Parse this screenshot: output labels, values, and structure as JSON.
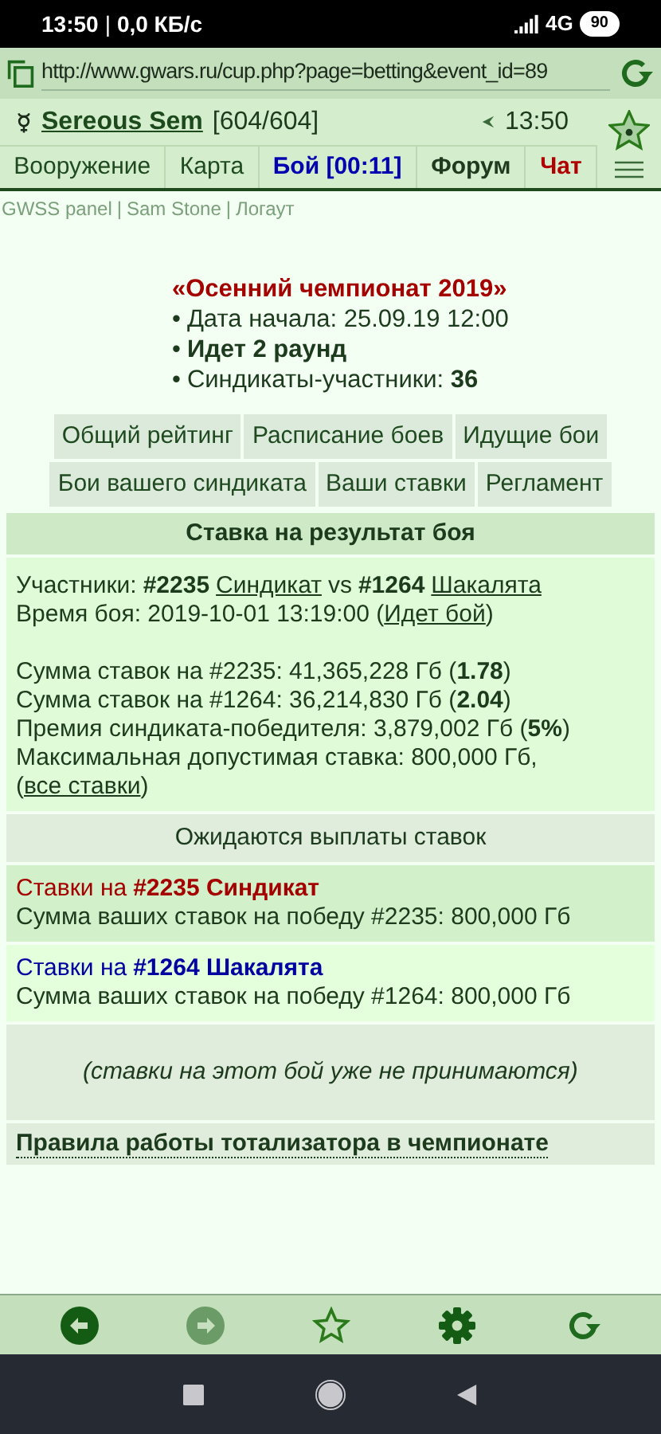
{
  "status_bar": {
    "time": "13:50",
    "separator": "|",
    "speed": "0,0 КБ/с",
    "network": "4G",
    "battery": "90"
  },
  "address_bar": {
    "url": "http://www.gwars.ru/cup.php?page=betting&event_id=89"
  },
  "header": {
    "user_name": "Sereous Sem",
    "hp": "[604/604]",
    "clock": "13:50",
    "nav": [
      {
        "label": "Вооружение",
        "kind": "normal"
      },
      {
        "label": "Карта",
        "kind": "normal"
      },
      {
        "label": "Бой [00:11]",
        "kind": "battle"
      },
      {
        "label": "Форум",
        "kind": "bold"
      },
      {
        "label": "Чат",
        "kind": "chat"
      }
    ]
  },
  "top_links": {
    "separator": "|",
    "items": [
      "GWSS panel",
      "Sam Stone",
      "Логаут"
    ]
  },
  "tournament": {
    "title": "«Осенний чемпионат 2019»",
    "bullet": "•",
    "lines": [
      {
        "text": "Дата начала: 25.09.19 12:00",
        "bold": false
      },
      {
        "text": "Идет 2 раунд",
        "bold": true
      },
      {
        "text": "Синдикаты-участники: **36**",
        "bold": false
      }
    ]
  },
  "menu_rows": [
    [
      "Общий рейтинг",
      "Расписание боев",
      "Идущие бои"
    ],
    [
      "Бои вашего синдиката",
      "Ваши ставки",
      "Регламент"
    ]
  ],
  "bet_panel": {
    "heading": "Ставка на результат боя",
    "participants": {
      "label": "Участники:",
      "team1_id": "#2235",
      "team1_name": "Синдикат",
      "vs": "vs",
      "team2_id": "#1264",
      "team2_name": "Шакалята"
    },
    "time": {
      "text": "Время боя: 2019-10-01 13:19:00 (",
      "link": "Идет бой",
      "suffix": ")"
    },
    "sums": [
      "Сумма ставок на #2235: 41,365,228 Гб (**1.78**)",
      "Сумма ставок на #1264: 36,214,830 Гб (**2.04**)",
      "Премия синдиката-победителя: 3,879,002 Гб (**5%**)"
    ],
    "max_bet": {
      "text": "Максимальная допустимая ставка: 800,000 Гб, (",
      "link": "все ставки",
      "suffix": ")"
    }
  },
  "pending_heading": "Ожидаются выплаты ставок",
  "bets": [
    {
      "label": "Ставки на",
      "team": "#2235 Синдикат",
      "sum": "Сумма ваших ставок на победу #2235: 800,000 Гб",
      "color": "#a40000"
    },
    {
      "label": "Ставки на",
      "team": "#1264 Шакалята",
      "sum": "Сумма ваших ставок на победу #1264: 800,000 Гб",
      "color": "#0000a0"
    }
  ],
  "notice": "(ставки на этот бой уже не принимаются)",
  "rules_link": "Правила работы тотализатора в чемпионате",
  "toolbar": [
    {
      "kind": "back",
      "disabled": false
    },
    {
      "kind": "forward",
      "disabled": true
    },
    {
      "kind": "star",
      "disabled": false
    },
    {
      "kind": "settings",
      "disabled": false
    },
    {
      "kind": "reload",
      "disabled": false
    }
  ]
}
